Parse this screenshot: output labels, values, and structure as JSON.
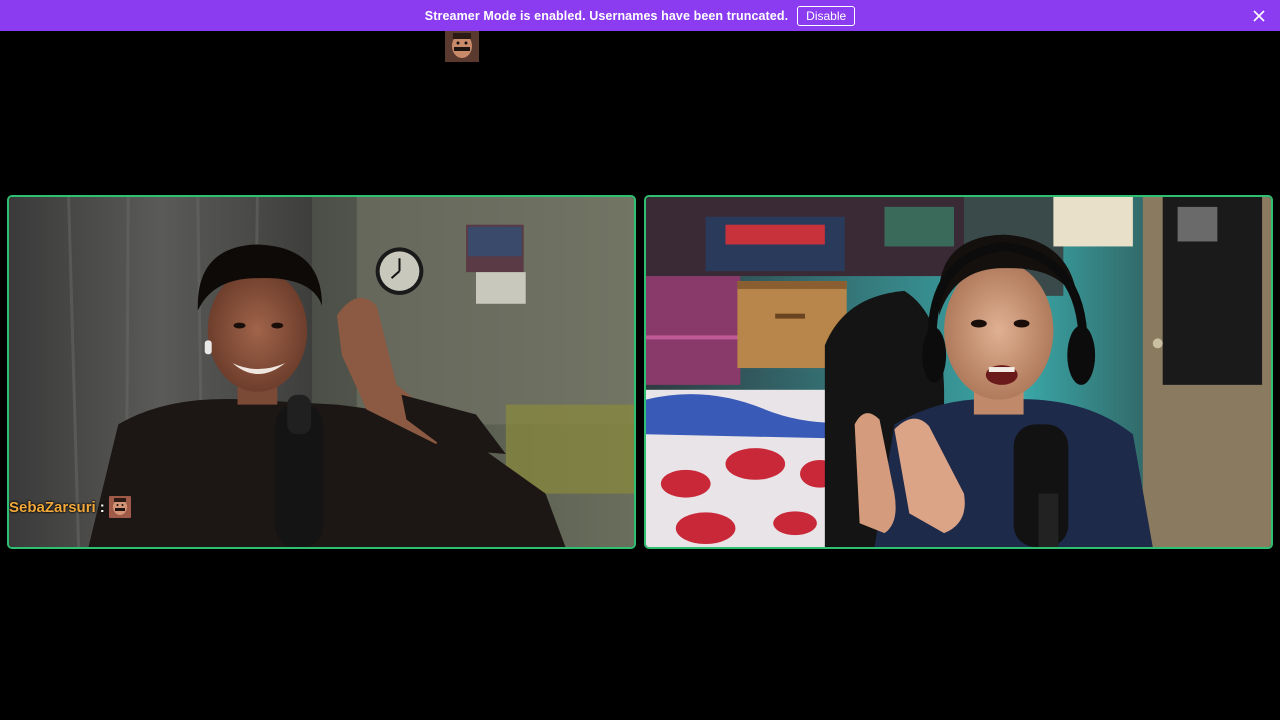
{
  "banner": {
    "message": "Streamer Mode is enabled. Usernames have been truncated.",
    "disable_label": "Disable",
    "background_color": "#8b3cf0",
    "close_icon": "close-icon"
  },
  "tiles": {
    "left": {
      "participant_name": "SebaZarsuri",
      "separator": ":",
      "speaking_border_color": "#2fbf71"
    },
    "right": {
      "speaking_border_color": "#2fbf71"
    }
  },
  "colors": {
    "background": "#000000",
    "username": "#f2a93b"
  }
}
